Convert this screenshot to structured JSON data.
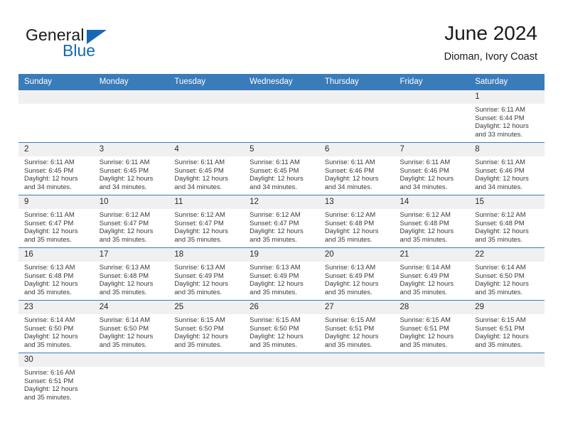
{
  "logo": {
    "name_top": "General",
    "name_bottom": "Blue",
    "accent_color": "#1668b3",
    "triangle_icon": "triangle-icon"
  },
  "header": {
    "title": "June 2024",
    "subtitle": "Dioman, Ivory Coast",
    "header_bg_color": "#3a7cba"
  },
  "weekday_headers": [
    "Sunday",
    "Monday",
    "Tuesday",
    "Wednesday",
    "Thursday",
    "Friday",
    "Saturday"
  ],
  "weeks": [
    [
      {
        "day": "",
        "blank": true
      },
      {
        "day": "",
        "blank": true
      },
      {
        "day": "",
        "blank": true
      },
      {
        "day": "",
        "blank": true
      },
      {
        "day": "",
        "blank": true
      },
      {
        "day": "",
        "blank": true
      },
      {
        "day": "1",
        "sunrise": "Sunrise: 6:11 AM",
        "sunset": "Sunset: 6:44 PM",
        "daylight_line1": "Daylight: 12 hours",
        "daylight_line2": "and 33 minutes."
      }
    ],
    [
      {
        "day": "2",
        "sunrise": "Sunrise: 6:11 AM",
        "sunset": "Sunset: 6:45 PM",
        "daylight_line1": "Daylight: 12 hours",
        "daylight_line2": "and 34 minutes."
      },
      {
        "day": "3",
        "sunrise": "Sunrise: 6:11 AM",
        "sunset": "Sunset: 6:45 PM",
        "daylight_line1": "Daylight: 12 hours",
        "daylight_line2": "and 34 minutes."
      },
      {
        "day": "4",
        "sunrise": "Sunrise: 6:11 AM",
        "sunset": "Sunset: 6:45 PM",
        "daylight_line1": "Daylight: 12 hours",
        "daylight_line2": "and 34 minutes."
      },
      {
        "day": "5",
        "sunrise": "Sunrise: 6:11 AM",
        "sunset": "Sunset: 6:45 PM",
        "daylight_line1": "Daylight: 12 hours",
        "daylight_line2": "and 34 minutes."
      },
      {
        "day": "6",
        "sunrise": "Sunrise: 6:11 AM",
        "sunset": "Sunset: 6:46 PM",
        "daylight_line1": "Daylight: 12 hours",
        "daylight_line2": "and 34 minutes."
      },
      {
        "day": "7",
        "sunrise": "Sunrise: 6:11 AM",
        "sunset": "Sunset: 6:46 PM",
        "daylight_line1": "Daylight: 12 hours",
        "daylight_line2": "and 34 minutes."
      },
      {
        "day": "8",
        "sunrise": "Sunrise: 6:11 AM",
        "sunset": "Sunset: 6:46 PM",
        "daylight_line1": "Daylight: 12 hours",
        "daylight_line2": "and 34 minutes."
      }
    ],
    [
      {
        "day": "9",
        "sunrise": "Sunrise: 6:11 AM",
        "sunset": "Sunset: 6:47 PM",
        "daylight_line1": "Daylight: 12 hours",
        "daylight_line2": "and 35 minutes."
      },
      {
        "day": "10",
        "sunrise": "Sunrise: 6:12 AM",
        "sunset": "Sunset: 6:47 PM",
        "daylight_line1": "Daylight: 12 hours",
        "daylight_line2": "and 35 minutes."
      },
      {
        "day": "11",
        "sunrise": "Sunrise: 6:12 AM",
        "sunset": "Sunset: 6:47 PM",
        "daylight_line1": "Daylight: 12 hours",
        "daylight_line2": "and 35 minutes."
      },
      {
        "day": "12",
        "sunrise": "Sunrise: 6:12 AM",
        "sunset": "Sunset: 6:47 PM",
        "daylight_line1": "Daylight: 12 hours",
        "daylight_line2": "and 35 minutes."
      },
      {
        "day": "13",
        "sunrise": "Sunrise: 6:12 AM",
        "sunset": "Sunset: 6:48 PM",
        "daylight_line1": "Daylight: 12 hours",
        "daylight_line2": "and 35 minutes."
      },
      {
        "day": "14",
        "sunrise": "Sunrise: 6:12 AM",
        "sunset": "Sunset: 6:48 PM",
        "daylight_line1": "Daylight: 12 hours",
        "daylight_line2": "and 35 minutes."
      },
      {
        "day": "15",
        "sunrise": "Sunrise: 6:12 AM",
        "sunset": "Sunset: 6:48 PM",
        "daylight_line1": "Daylight: 12 hours",
        "daylight_line2": "and 35 minutes."
      }
    ],
    [
      {
        "day": "16",
        "sunrise": "Sunrise: 6:13 AM",
        "sunset": "Sunset: 6:48 PM",
        "daylight_line1": "Daylight: 12 hours",
        "daylight_line2": "and 35 minutes."
      },
      {
        "day": "17",
        "sunrise": "Sunrise: 6:13 AM",
        "sunset": "Sunset: 6:48 PM",
        "daylight_line1": "Daylight: 12 hours",
        "daylight_line2": "and 35 minutes."
      },
      {
        "day": "18",
        "sunrise": "Sunrise: 6:13 AM",
        "sunset": "Sunset: 6:49 PM",
        "daylight_line1": "Daylight: 12 hours",
        "daylight_line2": "and 35 minutes."
      },
      {
        "day": "19",
        "sunrise": "Sunrise: 6:13 AM",
        "sunset": "Sunset: 6:49 PM",
        "daylight_line1": "Daylight: 12 hours",
        "daylight_line2": "and 35 minutes."
      },
      {
        "day": "20",
        "sunrise": "Sunrise: 6:13 AM",
        "sunset": "Sunset: 6:49 PM",
        "daylight_line1": "Daylight: 12 hours",
        "daylight_line2": "and 35 minutes."
      },
      {
        "day": "21",
        "sunrise": "Sunrise: 6:14 AM",
        "sunset": "Sunset: 6:49 PM",
        "daylight_line1": "Daylight: 12 hours",
        "daylight_line2": "and 35 minutes."
      },
      {
        "day": "22",
        "sunrise": "Sunrise: 6:14 AM",
        "sunset": "Sunset: 6:50 PM",
        "daylight_line1": "Daylight: 12 hours",
        "daylight_line2": "and 35 minutes."
      }
    ],
    [
      {
        "day": "23",
        "sunrise": "Sunrise: 6:14 AM",
        "sunset": "Sunset: 6:50 PM",
        "daylight_line1": "Daylight: 12 hours",
        "daylight_line2": "and 35 minutes."
      },
      {
        "day": "24",
        "sunrise": "Sunrise: 6:14 AM",
        "sunset": "Sunset: 6:50 PM",
        "daylight_line1": "Daylight: 12 hours",
        "daylight_line2": "and 35 minutes."
      },
      {
        "day": "25",
        "sunrise": "Sunrise: 6:15 AM",
        "sunset": "Sunset: 6:50 PM",
        "daylight_line1": "Daylight: 12 hours",
        "daylight_line2": "and 35 minutes."
      },
      {
        "day": "26",
        "sunrise": "Sunrise: 6:15 AM",
        "sunset": "Sunset: 6:50 PM",
        "daylight_line1": "Daylight: 12 hours",
        "daylight_line2": "and 35 minutes."
      },
      {
        "day": "27",
        "sunrise": "Sunrise: 6:15 AM",
        "sunset": "Sunset: 6:51 PM",
        "daylight_line1": "Daylight: 12 hours",
        "daylight_line2": "and 35 minutes."
      },
      {
        "day": "28",
        "sunrise": "Sunrise: 6:15 AM",
        "sunset": "Sunset: 6:51 PM",
        "daylight_line1": "Daylight: 12 hours",
        "daylight_line2": "and 35 minutes."
      },
      {
        "day": "29",
        "sunrise": "Sunrise: 6:15 AM",
        "sunset": "Sunset: 6:51 PM",
        "daylight_line1": "Daylight: 12 hours",
        "daylight_line2": "and 35 minutes."
      }
    ],
    [
      {
        "day": "30",
        "sunrise": "Sunrise: 6:16 AM",
        "sunset": "Sunset: 6:51 PM",
        "daylight_line1": "Daylight: 12 hours",
        "daylight_line2": "and 35 minutes."
      },
      {
        "day": "",
        "blank": true
      },
      {
        "day": "",
        "blank": true
      },
      {
        "day": "",
        "blank": true
      },
      {
        "day": "",
        "blank": true
      },
      {
        "day": "",
        "blank": true
      },
      {
        "day": "",
        "blank": true
      }
    ]
  ]
}
